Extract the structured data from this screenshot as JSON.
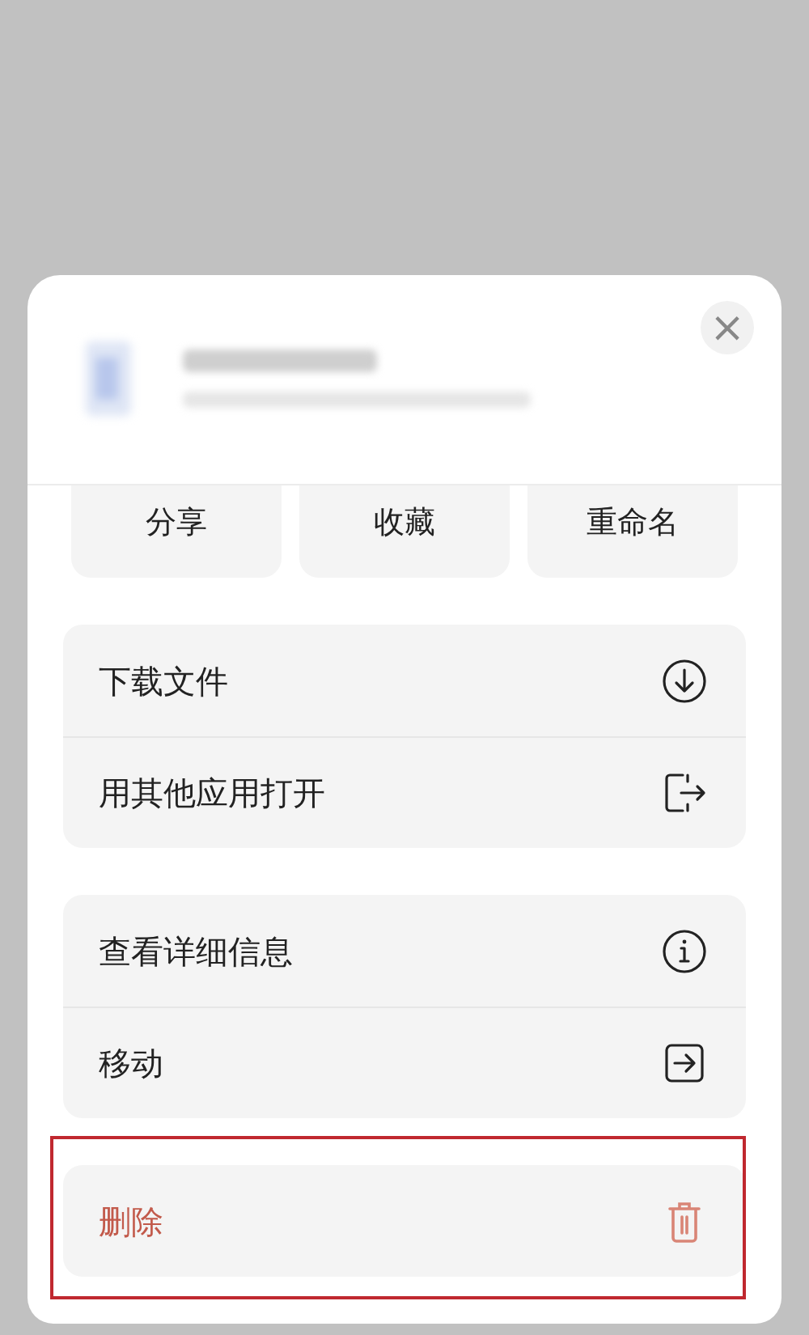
{
  "sheet": {
    "close_button": "×",
    "quick_actions": [
      {
        "label": "分享"
      },
      {
        "label": "收藏"
      },
      {
        "label": "重命名"
      }
    ],
    "groups": [
      {
        "highlighted": false,
        "items": [
          {
            "label": "下载文件",
            "kind": "download"
          },
          {
            "label": "用其他应用打开",
            "kind": "open-with"
          }
        ]
      },
      {
        "highlighted": false,
        "items": [
          {
            "label": "查看详细信息",
            "kind": "info"
          },
          {
            "label": "移动",
            "kind": "move"
          }
        ]
      },
      {
        "highlighted": true,
        "items": [
          {
            "label": "删除",
            "kind": "delete"
          }
        ]
      }
    ]
  }
}
